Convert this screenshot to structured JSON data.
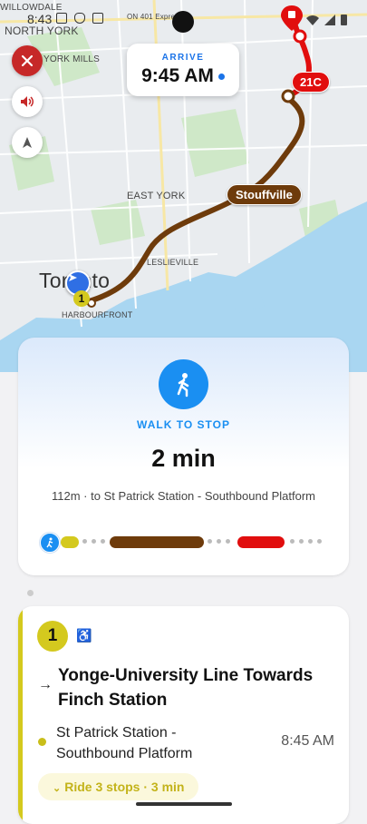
{
  "status_bar": {
    "time": "8:43"
  },
  "map": {
    "labels": {
      "willowdale": "WILLOWDALE",
      "north_york": "NORTH YORK",
      "york_mills": "YORK MILLS",
      "on401": "ON 401 Express",
      "east_york": "EAST YORK",
      "leslieville": "LESLIEVILLE",
      "toronto": "Toronto",
      "harbourfront": "HARBOURFRONT"
    },
    "route_labels": {
      "stouffville": "Stouffville",
      "bus": "21C",
      "start_badge": "1"
    },
    "colors": {
      "water": "#a9d6f1",
      "land": "#e9ecef",
      "park": "#cfe8c8",
      "road": "#ffffff",
      "brown_route": "#6e3b0b",
      "red_route": "#e10e0e",
      "yellow_route": "#d4c91e"
    }
  },
  "controls": {
    "close_icon": "close-icon",
    "sound_icon": "speaker-icon",
    "nav_icon": "navigation-icon"
  },
  "arrive": {
    "label": "ARRIVE",
    "time": "9:45 AM"
  },
  "walk_card": {
    "label": "WALK TO STOP",
    "minutes": "2 min",
    "description": "112m · to St Patrick Station - Southbound Platform",
    "accent": "#1a8ff2"
  },
  "step": {
    "badge": "1",
    "line": "Yonge-University Line Towards Finch Station",
    "stop_name": "St Patrick Station - Southbound Platform",
    "stop_time": "8:45 AM",
    "ride": "Ride 3 stops · 3 min",
    "line_color": "#d4c91e"
  }
}
